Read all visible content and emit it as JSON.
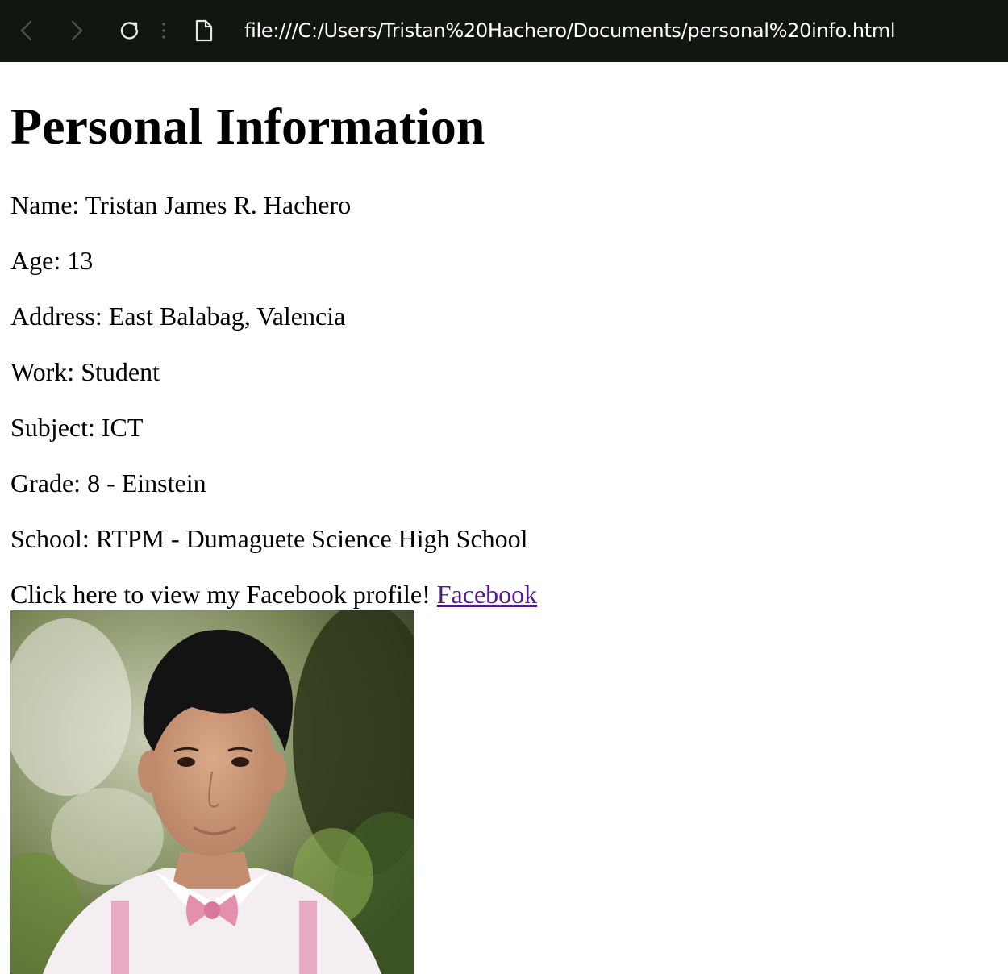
{
  "browser": {
    "url": "file:///C:/Users/Tristan%20Hachero/Documents/personal%20info.html",
    "icons": [
      "back-icon",
      "forward-icon",
      "reload-icon",
      "page-icon"
    ]
  },
  "page": {
    "title": "Personal Information",
    "name": "Name: Tristan James R. Hachero",
    "age": "Age: 13",
    "address": "Address: East Balabag, Valencia",
    "work": "Work: Student",
    "subject": "Subject: ICT",
    "grade": "Grade: 8 - Einstein",
    "school": "School: RTPM - Dumaguete Science High School",
    "facebook_prompt": "Click here to view my Facebook profile! ",
    "facebook_link": "Facebook"
  },
  "colors": {
    "toolbar_bg": "#121610",
    "link_visited": "#551a8b"
  }
}
